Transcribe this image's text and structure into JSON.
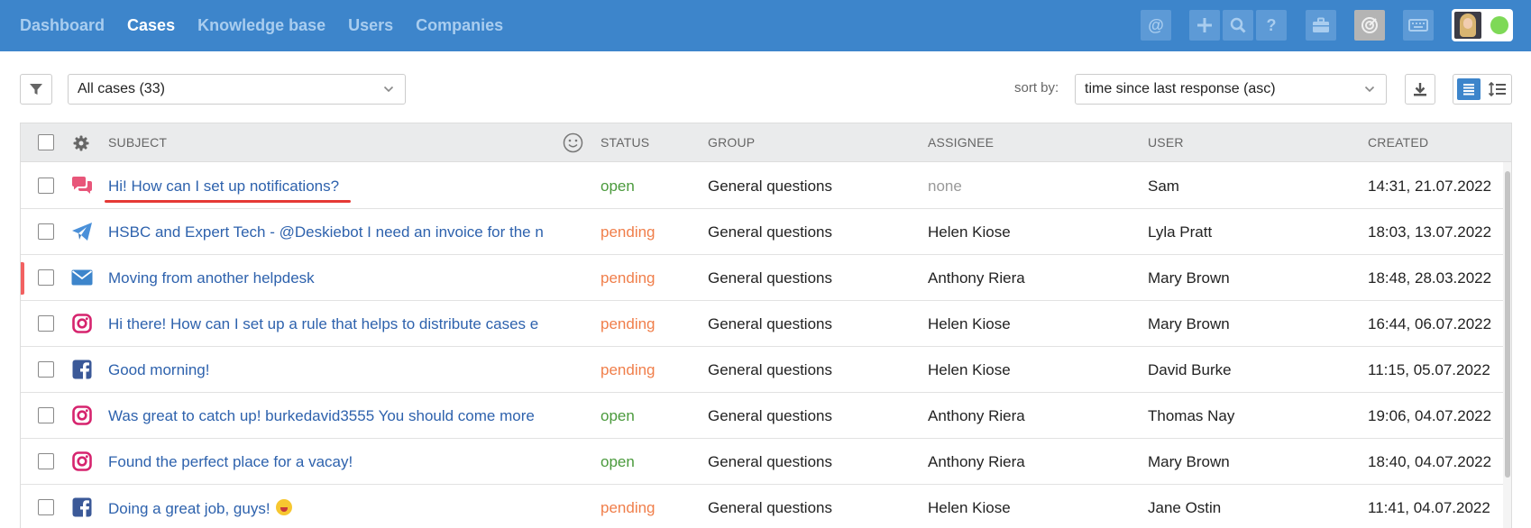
{
  "nav": {
    "items": [
      "Dashboard",
      "Cases",
      "Knowledge base",
      "Users",
      "Companies"
    ],
    "active": "Cases"
  },
  "topbar_icons": [
    "at-icon",
    "plus-icon",
    "search-icon",
    "help-icon",
    "briefcase-icon",
    "target-icon",
    "keyboard-icon"
  ],
  "toolbar": {
    "filter_select": "All cases (33)",
    "sort_label": "sort by:",
    "sort_select": "time since last response (asc)"
  },
  "table": {
    "headers": {
      "subject": "SUBJECT",
      "status": "STATUS",
      "group": "GROUP",
      "assignee": "ASSIGNEE",
      "user": "USER",
      "created": "CREATED"
    },
    "rows": [
      {
        "channel": "chat-icon",
        "subject": "Hi! How can I set up notifications?",
        "status": "open",
        "group": "General questions",
        "assignee": "none",
        "user": "Sam",
        "created": "14:31, 21.07.2022"
      },
      {
        "channel": "telegram-icon",
        "subject": "HSBC and Expert Tech - @Deskiebot I need an invoice for the n",
        "status": "pending",
        "group": "General questions",
        "assignee": "Helen Kiose",
        "user": "Lyla Pratt",
        "created": "18:03, 13.07.2022"
      },
      {
        "channel": "email-icon",
        "subject": "Moving from another helpdesk",
        "status": "pending",
        "group": "General questions",
        "assignee": "Anthony Riera",
        "user": "Mary Brown",
        "created": "18:48, 28.03.2022"
      },
      {
        "channel": "instagram-icon",
        "subject": "Hi there! How can I set up a rule that helps to distribute cases e",
        "status": "pending",
        "group": "General questions",
        "assignee": "Helen Kiose",
        "user": "Mary Brown",
        "created": "16:44, 06.07.2022"
      },
      {
        "channel": "facebook-icon",
        "subject": "Good morning!",
        "status": "pending",
        "group": "General questions",
        "assignee": "Helen Kiose",
        "user": "David Burke",
        "created": "11:15, 05.07.2022"
      },
      {
        "channel": "instagram-icon",
        "subject": "Was great to catch up! burkedavid3555 You should come more",
        "status": "open",
        "group": "General questions",
        "assignee": "Anthony Riera",
        "user": "Thomas Nay",
        "created": "19:06, 04.07.2022"
      },
      {
        "channel": "instagram-icon",
        "subject": "Found the perfect place for a vacay!",
        "status": "open",
        "group": "General questions",
        "assignee": "Anthony Riera",
        "user": "Mary Brown",
        "created": "18:40, 04.07.2022"
      },
      {
        "channel": "facebook-icon",
        "subject": "Doing a great job, guys!",
        "status": "pending",
        "group": "General questions",
        "assignee": "Helen Kiose",
        "user": "Jane Ostin",
        "created": "11:41, 04.07.2022"
      }
    ]
  },
  "colors": {
    "topbar": "#3d85cb",
    "open": "#4a9a3c",
    "pending": "#f07e4a",
    "link": "#2e62ad",
    "flag": "#f26161"
  }
}
